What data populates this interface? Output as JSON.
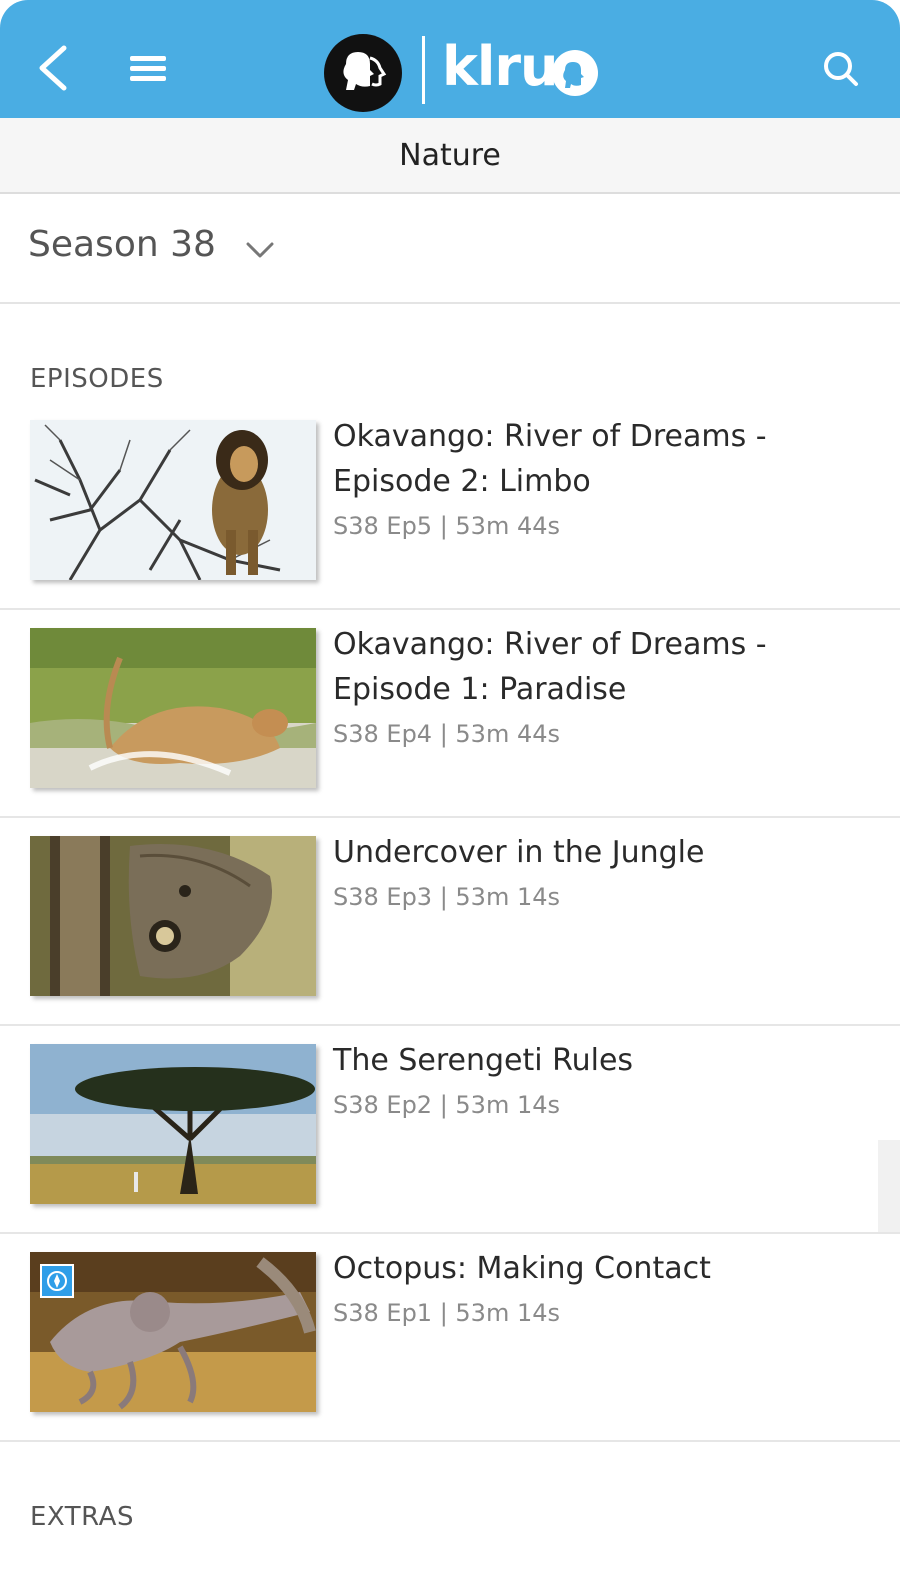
{
  "header": {
    "brand_text": "klru",
    "back_icon": "chevron-left-icon",
    "menu_icon": "hamburger-menu-icon",
    "search_icon": "search-icon",
    "bar_color": "#4aade3"
  },
  "show": {
    "title": "Nature"
  },
  "season_selector": {
    "label": "Season 38",
    "icon": "chevron-down-icon"
  },
  "sections": {
    "episodes": "EPISODES",
    "extras": "EXTRAS"
  },
  "episodes": [
    {
      "title": "Okavango: River of Dreams - Episode 2: Limbo",
      "meta": "S38 Ep5 | 53m 44s",
      "thumbnail": "lion-in-tree"
    },
    {
      "title": "Okavango: River of Dreams - Episode 1: Paradise",
      "meta": "S38 Ep4 | 53m 44s",
      "thumbnail": "lioness-leaping-water"
    },
    {
      "title": "Undercover in the Jungle",
      "meta": "S38 Ep3 | 53m 14s",
      "thumbnail": "owl-butterfly"
    },
    {
      "title": "The Serengeti Rules",
      "meta": "S38 Ep2 | 53m 14s",
      "thumbnail": "acacia-tree-savanna"
    },
    {
      "title": "Octopus: Making Contact",
      "meta": "S38 Ep1 | 53m 14s",
      "thumbnail": "octopus",
      "badge": "passport-compass-icon"
    }
  ]
}
